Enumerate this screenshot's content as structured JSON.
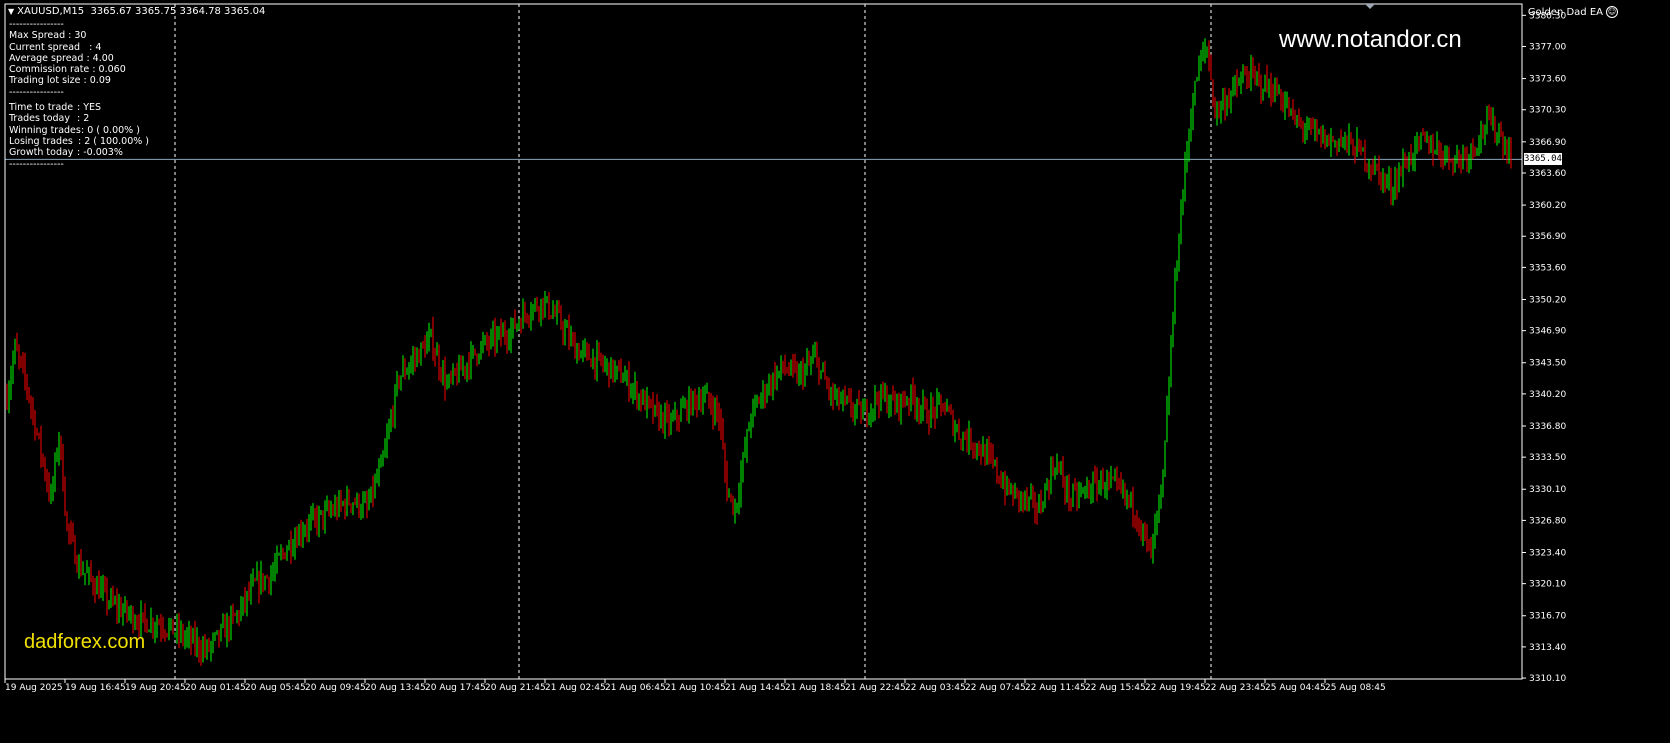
{
  "header": {
    "symbol": "XAUUSD,M15",
    "ohlc": "3365.67 3365.75 3364.78 3365.04",
    "ea_name": "Golden Dad EA"
  },
  "stats": {
    "sep1": "----------------",
    "rows_a": [
      {
        "k": "Max Spread",
        "v": ": 30"
      },
      {
        "k": "Current spread",
        "v": ": 4"
      },
      {
        "k": "Average spread",
        "v": ": 4.00"
      },
      {
        "k": "Commission rate",
        "v": ": 0.060"
      },
      {
        "k": "Trading lot size",
        "v": ": 0.09"
      }
    ],
    "sep2": "----------------",
    "rows_b": [
      {
        "k": "Time to trade",
        "v": ": YES"
      },
      {
        "k": "Trades today",
        "v": ": 2"
      },
      {
        "k": "Winning trades",
        "v": ": 0 ( 0.00% )"
      },
      {
        "k": "Losing trades",
        "v": ": 2 ( 100.00% )"
      },
      {
        "k": "Growth today",
        "v": ": -0.003%"
      }
    ],
    "sep3": "----------------"
  },
  "watermarks": {
    "site": "www.notandor.cn",
    "brand": "dadforex.com"
  },
  "current_price": "3365.04",
  "colors": {
    "background": "#000000",
    "bull": "#00ff00",
    "bear": "#ff0000",
    "grid": "#ffffff",
    "price_line": "#8aa7c0",
    "watermark_brand": "#f0e000"
  },
  "chart_data": {
    "type": "candlestick",
    "symbol": "XAUUSD",
    "timeframe": "M15",
    "ylim": [
      3310.0,
      3381.5
    ],
    "y_ticks": [
      "3380.30",
      "3377.00",
      "3373.60",
      "3370.30",
      "3366.90",
      "3363.60",
      "3360.20",
      "3356.90",
      "3353.60",
      "3350.20",
      "3346.90",
      "3343.50",
      "3340.20",
      "3336.80",
      "3333.50",
      "3330.10",
      "3326.80",
      "3323.40",
      "3320.10",
      "3316.70",
      "3313.40",
      "3310.10"
    ],
    "x_ticks": [
      "19 Aug 2025",
      "19 Aug 16:45",
      "19 Aug 20:45",
      "20 Aug 01:45",
      "20 Aug 05:45",
      "20 Aug 09:45",
      "20 Aug 13:45",
      "20 Aug 17:45",
      "20 Aug 21:45",
      "21 Aug 02:45",
      "21 Aug 06:45",
      "21 Aug 10:45",
      "21 Aug 14:45",
      "21 Aug 18:45",
      "21 Aug 22:45",
      "22 Aug 03:45",
      "22 Aug 07:45",
      "22 Aug 11:45",
      "22 Aug 15:45",
      "22 Aug 19:45",
      "22 Aug 23:45",
      "25 Aug 04:45",
      "25 Aug 08:45"
    ],
    "day_separators": 4,
    "current_price": 3365.04,
    "anchors": [
      [
        0,
        3340
      ],
      [
        4,
        3345
      ],
      [
        10,
        3341
      ],
      [
        15,
        3336
      ],
      [
        19,
        3332
      ],
      [
        22,
        3329
      ],
      [
        26,
        3336
      ],
      [
        30,
        3326
      ],
      [
        36,
        3322
      ],
      [
        44,
        3320
      ],
      [
        52,
        3318
      ],
      [
        60,
        3317
      ],
      [
        68,
        3316
      ],
      [
        76,
        3316
      ],
      [
        84,
        3315
      ],
      [
        92,
        3314
      ],
      [
        100,
        3313
      ],
      [
        108,
        3315
      ],
      [
        116,
        3317
      ],
      [
        124,
        3320
      ],
      [
        132,
        3321
      ],
      [
        140,
        3324
      ],
      [
        148,
        3326
      ],
      [
        156,
        3327
      ],
      [
        164,
        3328
      ],
      [
        172,
        3329
      ],
      [
        180,
        3328
      ],
      [
        188,
        3333
      ],
      [
        196,
        3342
      ],
      [
        204,
        3344
      ],
      [
        212,
        3346
      ],
      [
        220,
        3341
      ],
      [
        228,
        3343
      ],
      [
        236,
        3345
      ],
      [
        244,
        3346
      ],
      [
        252,
        3347
      ],
      [
        260,
        3349
      ],
      [
        268,
        3350
      ],
      [
        276,
        3348
      ],
      [
        284,
        3345
      ],
      [
        292,
        3344
      ],
      [
        300,
        3343
      ],
      [
        308,
        3342
      ],
      [
        316,
        3340
      ],
      [
        324,
        3338
      ],
      [
        332,
        3337
      ],
      [
        340,
        3339
      ],
      [
        348,
        3340
      ],
      [
        356,
        3338
      ],
      [
        360,
        3330
      ],
      [
        364,
        3328
      ],
      [
        372,
        3338
      ],
      [
        380,
        3341
      ],
      [
        388,
        3343
      ],
      [
        396,
        3342
      ],
      [
        404,
        3344
      ],
      [
        412,
        3340
      ],
      [
        420,
        3339
      ],
      [
        428,
        3338
      ],
      [
        436,
        3340
      ],
      [
        444,
        3339
      ],
      [
        452,
        3340
      ],
      [
        460,
        3338
      ],
      [
        468,
        3339
      ],
      [
        476,
        3336
      ],
      [
        484,
        3335
      ],
      [
        492,
        3333
      ],
      [
        500,
        3330
      ],
      [
        508,
        3329
      ],
      [
        516,
        3328
      ],
      [
        524,
        3333
      ],
      [
        532,
        3329
      ],
      [
        540,
        3330
      ],
      [
        548,
        3331
      ],
      [
        556,
        3330
      ],
      [
        564,
        3328
      ],
      [
        572,
        3323
      ],
      [
        578,
        3331
      ],
      [
        584,
        3352
      ],
      [
        588,
        3362
      ],
      [
        592,
        3370
      ],
      [
        596,
        3375
      ],
      [
        600,
        3377
      ],
      [
        604,
        3370
      ],
      [
        612,
        3372
      ],
      [
        620,
        3374
      ],
      [
        628,
        3373
      ],
      [
        636,
        3372
      ],
      [
        644,
        3369
      ],
      [
        652,
        3368
      ],
      [
        660,
        3367
      ],
      [
        668,
        3367
      ],
      [
        676,
        3366
      ],
      [
        684,
        3364
      ],
      [
        692,
        3362
      ],
      [
        700,
        3365
      ],
      [
        708,
        3367
      ],
      [
        716,
        3366
      ],
      [
        724,
        3365
      ],
      [
        732,
        3366
      ],
      [
        740,
        3369
      ],
      [
        746,
        3368
      ],
      [
        752,
        3365
      ]
    ]
  }
}
